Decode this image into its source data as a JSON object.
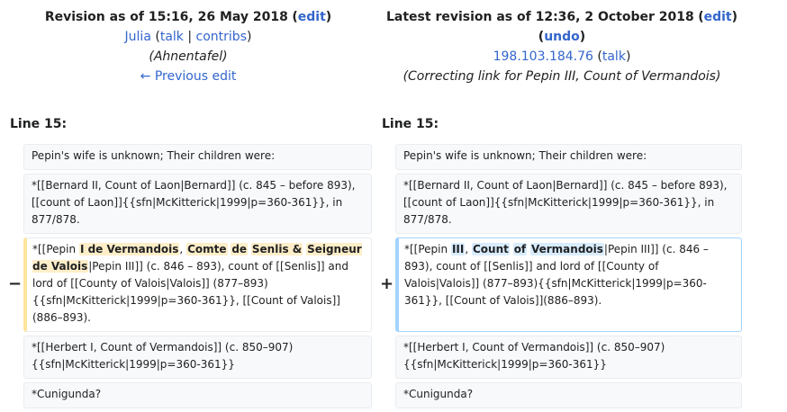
{
  "left_header": {
    "title": "Revision as of 15:16, 26 May 2018",
    "edit": "edit",
    "user": "Julia",
    "talk": "talk",
    "contribs": "contribs",
    "summary": "(Ahnentafel)",
    "prev_edit": "← Previous edit"
  },
  "right_header": {
    "title": "Latest revision as of 12:36, 2 October 2018",
    "edit": "edit",
    "undo": "undo",
    "user": "198.103.184.76",
    "talk": "talk",
    "summary": "(Correcting link for Pepin III, Count of Vermandois)"
  },
  "line_label": "Line 15:",
  "markers": {
    "minus": "−",
    "plus": "+"
  },
  "context": {
    "row1": "Pepin's wife is unknown; Their children were:",
    "row2": "*[[Bernard II, Count of Laon|Bernard]] (c. 845 – before 893), [[count of Laon]]{{sfn|McKitterick|1999|p=360-361}}, in 877/878.",
    "row4": "*[[Herbert I, Count of Vermandois]] (c. 850–907) {{sfn|McKitterick|1999|p=360-361}}",
    "row5": "*Cunigunda?"
  },
  "deleted": {
    "p1": "*[[Pepin ",
    "h1": "I de Vermandois",
    "p2": ", ",
    "h2": "Comte",
    "p3": " ",
    "h3": "de",
    "p4": " ",
    "h4": "Senlis &",
    "p5": " ",
    "h5": "Seigneur de Valois",
    "p6": "|Pepin III]] (c. 846 – 893), count of [[Senlis]] and lord of [[County of Valois|Valois]] (877–893){{sfn|McKitterick|1999|p=360-361}}, [[Count of Valois]](886–893)."
  },
  "added": {
    "p1": "*[[Pepin ",
    "h1": "III",
    "p2": ", ",
    "h2": "Count",
    "p3": " ",
    "h3": "of",
    "p4": " ",
    "h4": "Vermandois",
    "p5": "|Pepin III]] (c. 846 – 893), count of [[Senlis]] and lord of [[County of Valois|Valois]] (877–893){{sfn|McKitterick|1999|p=360-361}}, [[Count of Valois]](886–893)."
  }
}
